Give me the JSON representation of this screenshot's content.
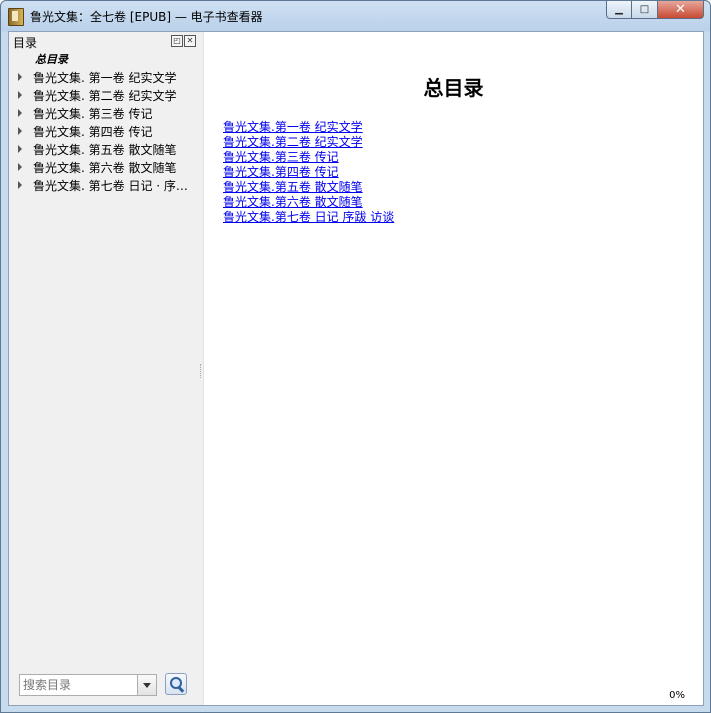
{
  "window": {
    "title": "鲁光文集：全七卷 [EPUB] — 电子书查看器",
    "minimize_label": "▁",
    "maximize_label": "□",
    "close_label": "✕"
  },
  "sidebar": {
    "title": "目录",
    "float_label": "◰",
    "close_label": "✕",
    "root_item": "总目录",
    "items": [
      {
        "label": "鲁光文集. 第一卷  纪实文学"
      },
      {
        "label": "鲁光文集. 第二卷  纪实文学"
      },
      {
        "label": "鲁光文集. 第三卷  传记"
      },
      {
        "label": "鲁光文集. 第四卷  传记"
      },
      {
        "label": "鲁光文集. 第五卷  散文随笔"
      },
      {
        "label": "鲁光文集. 第六卷  散文随笔"
      },
      {
        "label": "鲁光文集. 第七卷  日记 · 序…"
      }
    ],
    "search": {
      "placeholder": "搜索目录",
      "value": ""
    }
  },
  "content": {
    "heading": "总目录",
    "links": [
      "鲁光文集.第一卷 纪实文学",
      "鲁光文集.第二卷 纪实文学",
      "鲁光文集.第三卷 传记",
      "鲁光文集.第四卷 传记",
      "鲁光文集.第五卷 散文随笔",
      "鲁光文集.第六卷 散文随笔",
      "鲁光文集.第七卷 日记 序跋 访谈"
    ],
    "progress": "0%"
  },
  "icons": {
    "app": "ebook-app-icon",
    "expand": "expand-arrow-icon",
    "search": "magnifier-icon",
    "dropdown": "chevron-down-icon"
  }
}
